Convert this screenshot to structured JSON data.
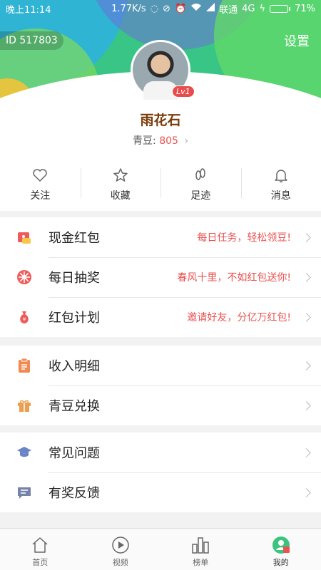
{
  "status_bar": {
    "time": "晚上11:14",
    "speed": "1.77K/s",
    "carrier": "联通",
    "network": "4G",
    "battery": "71%",
    "battery_level": 0.71
  },
  "profile": {
    "id_label": "ID 517803",
    "settings_label": "设置",
    "username": "雨花石",
    "level": "Lv1",
    "beans_label": "青豆:",
    "beans_value": "805"
  },
  "quick_actions": [
    {
      "label": "关注",
      "icon": "heart-icon"
    },
    {
      "label": "收藏",
      "icon": "star-icon"
    },
    {
      "label": "足迹",
      "icon": "footprint-icon"
    },
    {
      "label": "消息",
      "icon": "bell-icon"
    }
  ],
  "menu_group_1": [
    {
      "label": "现金红包",
      "promo": "每日任务，轻松领豆!",
      "icon": "red-envelope-icon"
    },
    {
      "label": "每日抽奖",
      "promo": "春风十里，不如红包送你!",
      "icon": "lottery-wheel-icon"
    },
    {
      "label": "红包计划",
      "promo": "邀请好友，分亿万红包!",
      "icon": "money-bag-icon"
    }
  ],
  "menu_group_2": [
    {
      "label": "收入明细",
      "icon": "clipboard-icon"
    },
    {
      "label": "青豆兑换",
      "icon": "gift-icon"
    }
  ],
  "menu_group_3": [
    {
      "label": "常见问题",
      "icon": "graduation-cap-icon"
    },
    {
      "label": "有奖反馈",
      "icon": "chat-icon"
    }
  ],
  "tabs": [
    {
      "label": "首页",
      "icon": "home-icon"
    },
    {
      "label": "视频",
      "icon": "play-icon"
    },
    {
      "label": "榜单",
      "icon": "ranking-icon"
    },
    {
      "label": "我的",
      "icon": "profile-icon",
      "active": true
    }
  ],
  "colors": {
    "accent": "#ea5151",
    "username": "#7a3b0a",
    "tab_active": "#3cc47c"
  }
}
